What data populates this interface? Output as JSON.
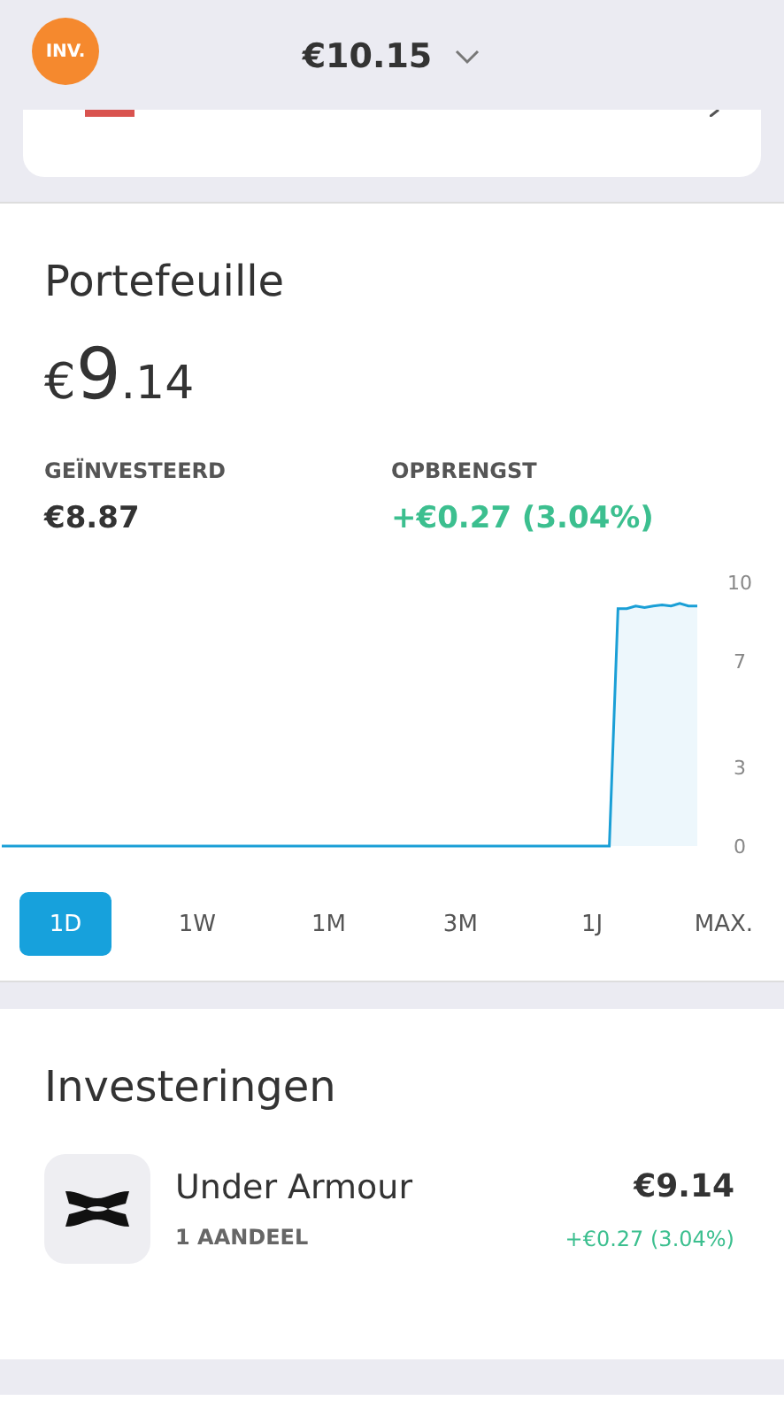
{
  "header": {
    "avatar": "INV.",
    "balance": "€10.15"
  },
  "portfolio": {
    "title": "Portefeuille",
    "value_main": "9",
    "value_currency": "€",
    "value_cents": ".14",
    "stats": [
      {
        "label": "GEÏNVESTEERD",
        "value": "€8.87",
        "kind": "neutral"
      },
      {
        "label": "OPBRENGST",
        "value": "+€0.27 (3.04%)",
        "kind": "positive"
      }
    ],
    "chart_data": {
      "type": "area",
      "ylim": [
        0,
        10
      ],
      "yticks": [
        0,
        3,
        7,
        10
      ],
      "categories": [
        null,
        null,
        null,
        null,
        null,
        null,
        null,
        null,
        null,
        null,
        null,
        null,
        null,
        null,
        null,
        null,
        null,
        null,
        null,
        null,
        null,
        null,
        null,
        null,
        null,
        null,
        null,
        null,
        null,
        null,
        null,
        null,
        null,
        null,
        null,
        null,
        null,
        null,
        null,
        null,
        null,
        null,
        null,
        null,
        null,
        null,
        null,
        null,
        null,
        null,
        null,
        null,
        null,
        null,
        null,
        null,
        null,
        null,
        null,
        null,
        null,
        null,
        null,
        null,
        null,
        null,
        null,
        null,
        null,
        null,
        null,
        null,
        null,
        null,
        null,
        null,
        null,
        null,
        null,
        null
      ],
      "series": [
        {
          "color": "#1a9fd6",
          "values": [
            0,
            0,
            0,
            0,
            0,
            0,
            0,
            0,
            0,
            0,
            0,
            0,
            0,
            0,
            0,
            0,
            0,
            0,
            0,
            0,
            0,
            0,
            0,
            0,
            0,
            0,
            0,
            0,
            0,
            0,
            0,
            0,
            0,
            0,
            0,
            0,
            0,
            0,
            0,
            0,
            0,
            0,
            0,
            0,
            0,
            0,
            0,
            0,
            0,
            0,
            0,
            0,
            0,
            0,
            0,
            0,
            0,
            0,
            0,
            0,
            0,
            0,
            0,
            0,
            0,
            0,
            0,
            0,
            0,
            0,
            9.0,
            9.0,
            9.1,
            9.05,
            9.1,
            9.15,
            9.1,
            9.2,
            9.1,
            9.1
          ]
        }
      ]
    },
    "periods": [
      {
        "label": "1D",
        "selected": true
      },
      {
        "label": "1W",
        "selected": false
      },
      {
        "label": "1M",
        "selected": false
      },
      {
        "label": "3M",
        "selected": false
      },
      {
        "label": "1J",
        "selected": false
      },
      {
        "label": "MAX.",
        "selected": false
      }
    ]
  },
  "investments": {
    "title": "Investeringen",
    "items": [
      {
        "name": "Under Armour",
        "shares": "1 AANDEEL",
        "value": "€9.14",
        "change": "+€0.27 (3.04%)"
      }
    ]
  }
}
